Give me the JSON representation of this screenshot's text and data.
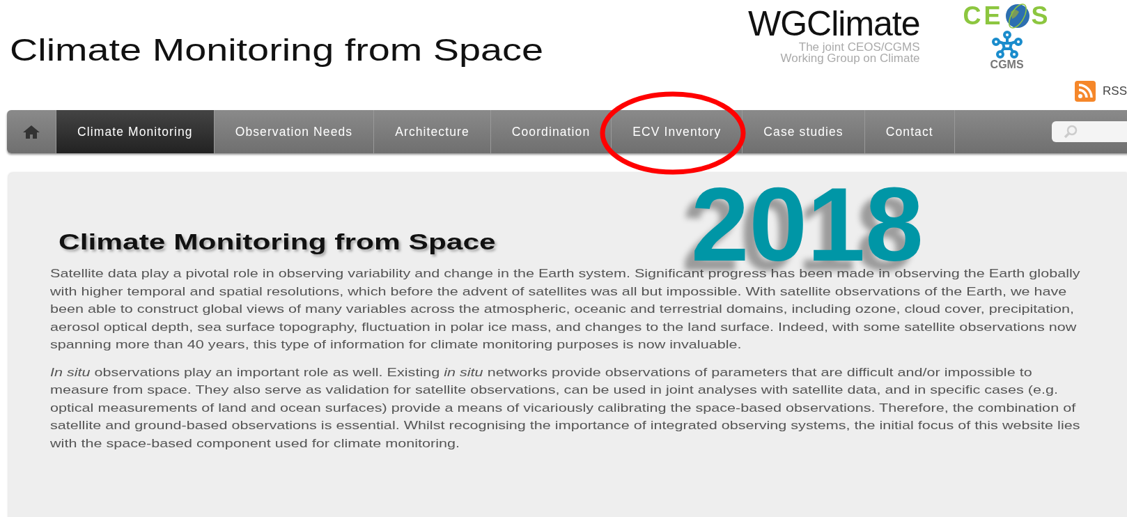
{
  "header": {
    "title": "Climate Monitoring from Space",
    "wg_logo": {
      "name": "WGClimate",
      "tagline": [
        "The joint CEOS/CGMS",
        "Working Group on Climate"
      ]
    },
    "ceos_logo": {
      "left": "CE",
      "right": "S"
    },
    "cgms_logo": {
      "label": "CGMS"
    },
    "rss": {
      "label": "RSS"
    }
  },
  "nav": {
    "items": [
      {
        "kind": "home",
        "selected": false
      },
      {
        "kind": "text",
        "label": "Climate Monitoring",
        "selected": true
      },
      {
        "kind": "text",
        "label": "Observation Needs",
        "selected": false
      },
      {
        "kind": "text",
        "label": "Architecture",
        "selected": false
      },
      {
        "kind": "text",
        "label": "Coordination",
        "selected": false
      },
      {
        "kind": "text",
        "label": "ECV Inventory",
        "selected": false
      },
      {
        "kind": "text",
        "label": "Case studies",
        "selected": false
      },
      {
        "kind": "text",
        "label": "Contact",
        "selected": false
      }
    ],
    "search": {
      "kind": "search"
    }
  },
  "annotation": {
    "year": "2018"
  },
  "content": {
    "heading": "Climate Monitoring from Space",
    "paragraphs": [
      "Satellite data play a pivotal role in observing variability and change in the Earth system. Significant progress has been made in observing the Earth globally with higher temporal and spatial resolutions, which before the advent of satellites was all but impossible. With satellite observations of the Earth, we have been able to construct global views of many variables across the atmospheric, oceanic and terrestrial domains, including ozone, cloud cover, precipitation, aerosol optical depth, sea surface topography, fluctuation in polar ice mass, and changes to the land surface. Indeed, with some satellite observations now spanning more than 40 years, this type of information for climate monitoring purposes is now invaluable.",
      "*In situ* observations play an important role as well. Existing *in situ* networks provide observations of parameters that are difficult and/or impossible to measure from space. They also serve as validation for satellite observations, can be used in joint analyses with satellite data, and in specific cases (e.g. optical measurements of land and ocean surfaces) provide a means of vicariously calibrating the space-based observations. Therefore, the combination of satellite and ground-based observations is essential. Whilst recognising the importance of integrated observing systems, the initial focus of this website lies with the space-based component used for climate monitoring."
    ]
  }
}
